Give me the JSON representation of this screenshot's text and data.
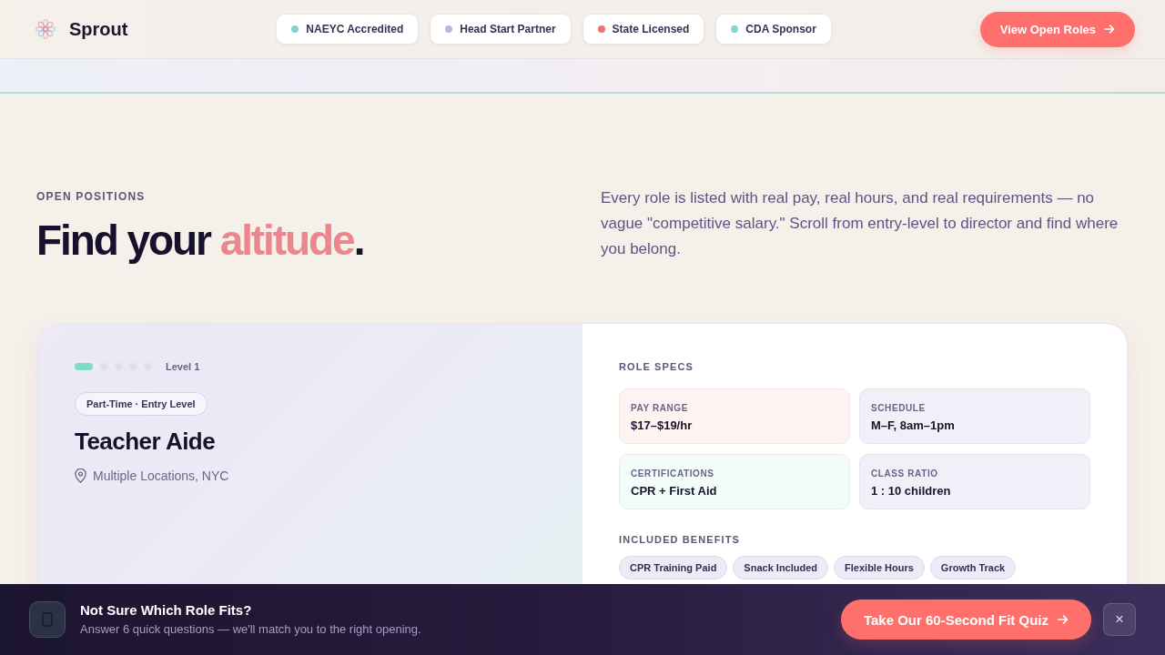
{
  "header": {
    "brand": "Sprout",
    "badges": [
      {
        "label": "NAEYC Accredited",
        "color": "#7fd6d2"
      },
      {
        "label": "Head Start Partner",
        "color": "#bdb5dc"
      },
      {
        "label": "State Licensed",
        "color": "#f07070"
      },
      {
        "label": "CDA Sponsor",
        "color": "#7fd6d2"
      }
    ],
    "cta": "View Open Roles"
  },
  "positions": {
    "eyebrow": "OPEN POSITIONS",
    "title": {
      "lead": "Find your ",
      "highlight": "altitude",
      "trail": "."
    },
    "intro": "Every role is listed with real pay, real hours, and real requirements — no vague \"competitive salary.\" Scroll from entry-level to director and find where you belong."
  },
  "role": {
    "steps": [
      {
        "active": true
      },
      {
        "active": false
      },
      {
        "active": false
      },
      {
        "active": false
      },
      {
        "active": false
      }
    ],
    "level_label": "Level 1",
    "tag": "Part-Time · Entry Level",
    "title": "Teacher Aide",
    "location": "Multiple Locations, NYC",
    "specs_heading": "ROLE SPECS",
    "specs": [
      {
        "label": "PAY RANGE",
        "value": "$17–$19/hr",
        "color": "#fff3f1"
      },
      {
        "label": "SCHEDULE",
        "value": "M–F, 8am–1pm",
        "color": "#f2eff8"
      },
      {
        "label": "CERTIFICATIONS",
        "value": "CPR + First Aid",
        "color": "#f2fcf9"
      },
      {
        "label": "CLASS RATIO",
        "value": "1 : 10 children",
        "color": "#f2eff8"
      }
    ],
    "benefits_heading": "INCLUDED BENEFITS",
    "benefits": [
      "CPR Training Paid",
      "Snack Included",
      "Flexible Hours",
      "Growth Track"
    ]
  },
  "quiz_banner": {
    "title": "Not Sure Which Role Fits?",
    "subtitle": "Answer 6 quick questions — we'll match you to the right opening.",
    "button": "Take Our 60-Second Fit Quiz",
    "close": "×"
  }
}
